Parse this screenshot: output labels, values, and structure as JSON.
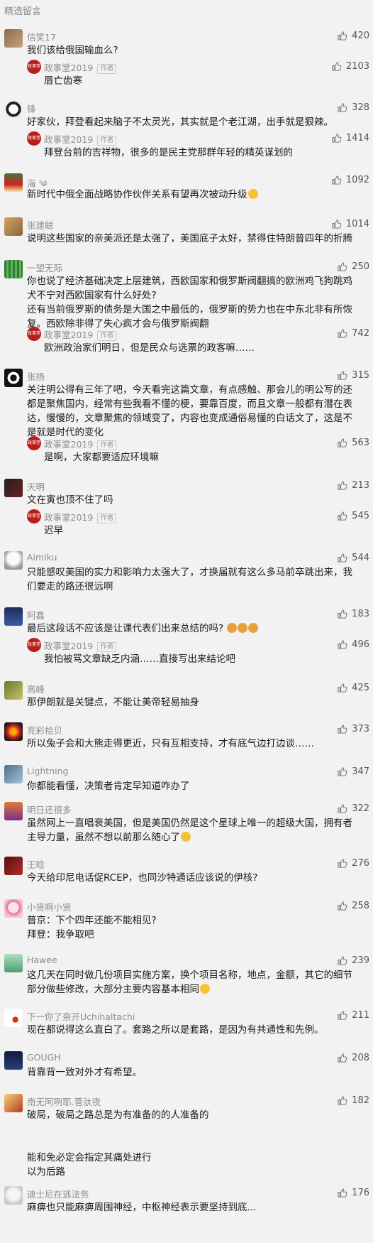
{
  "section_title": "精选留言",
  "author_name": "政事堂2019",
  "author_badge": "作者",
  "author_avatar_text": "政事堂",
  "like_icon": "thumbs-up-outline-icon",
  "comments": [
    {
      "name": "信笑17",
      "text": "我们该给俄国输血么?",
      "likes": "420",
      "reply": {
        "text": "唇亡齿寒",
        "likes": "2103"
      }
    },
    {
      "name": "锋",
      "text": "好家伙，拜登看起来脑子不太灵光，其实就是个老江湖，出手就是狠辣。",
      "likes": "328",
      "reply": {
        "text": "拜登台前的吉祥物，很多的是民主党那群年轻的精英谋划的",
        "likes": "1414"
      }
    },
    {
      "name": "海 ༄",
      "text": "新时代中俄全面战略协作伙伴关系有望再次被动升级",
      "likes": "1092"
    },
    {
      "name": "张建聪",
      "text": "说明这些国家的亲美派还是太强了，美国底子太好，禁得住特朗普四年的折腾",
      "likes": "1014"
    },
    {
      "name": "一望无际",
      "text": "你也说了经济基础决定上层建筑，西欧国家和俄罗斯阀翻搞的欧洲鸡飞狗跳鸡犬不宁对西欧国家有什么好处?\n还有当前俄罗斯的债务是大国之中最低的，俄罗斯的势力也在中东北非有所恢复。西欧除非得了失心疯才会与俄罗斯阀翻",
      "likes": "250",
      "reply": {
        "text": "欧洲政治家们明日，但是民众与选票的政客嘛……",
        "likes": "742"
      }
    },
    {
      "name": "张扬",
      "text": "关注明公得有三年了吧，今天看完这篇文章，有点感触、那会儿的明公写的还都是聚焦国内，经常有些我看不懂的梗，要靠百度，而且文章一般都有潜在表达，慢慢的，文章聚焦的领域变了，内容也变成通俗易懂的白话文了，这是不是就是时代的变化",
      "likes": "315",
      "reply": {
        "text": "是啊，大家都要适应环境嘛",
        "likes": "563"
      }
    },
    {
      "name": "天明",
      "text": "文在寅也顶不住了吗",
      "likes": "213",
      "reply": {
        "text": "迟早",
        "likes": "545"
      }
    },
    {
      "name": "Aimiku",
      "text": "只能感叹美国的实力和影响力太强大了，才换届就有这么多马前卒跳出来，我们要走的路还很远啊",
      "likes": "544"
    },
    {
      "name": "阿鑫",
      "text": "最后这段话不应该是让课代表们出来总结的吗?",
      "likes": "183",
      "reply": {
        "text": "我怕被骂文章缺乏内涵……直接写出来结论吧",
        "likes": "496"
      }
    },
    {
      "name": "高峰",
      "text": "那伊朗就是关键点，不能让美帝轻易抽身",
      "likes": "425"
    },
    {
      "name": "竞彩拾贝",
      "text": "所以兔子会和大熊走得更近，只有互相支持，才有底气边打边谈……",
      "likes": "373"
    },
    {
      "name": "Lightning",
      "text": "你都能看懂，决策者肯定早知道咋办了",
      "likes": "347"
    },
    {
      "name": "明日还很多",
      "text": "虽然网上一直唱衰美国，但是美国仍然是这个星球上唯一的超级大国，拥有者主导力量，虽然不想以前那么随心了",
      "likes": "322"
    },
    {
      "name": "王晗",
      "text": "今天给印尼电话促RCEP，也同沙特通话应该说的伊核?",
      "likes": "276"
    },
    {
      "name": "小贤啊小贤",
      "text": "普京：下个四年还能不能相见?\n拜登：我争取吧",
      "likes": "258"
    },
    {
      "name": "Hawee",
      "text": "这几天在同时做几份项目实施方案，换个项目名称，地点，金额，其它的细节部分做些修改，大部分主要内容基本相同",
      "likes": "239"
    },
    {
      "name": "下一你了奈开Uchihaltachi",
      "text": "现在都说得这么直白了。套路之所以是套路，是因为有共通性和先例。",
      "likes": "211"
    },
    {
      "name": "GOUGH",
      "text": "背靠背一致对外才有希望。",
      "likes": "208"
    },
    {
      "name": "南无阿咧耶.菩驮夜",
      "text": "破局，破局之路总是为有准备的的人准备的\n\n\n能和免必定会指定其痛处进行\n以为后路",
      "likes": "182"
    },
    {
      "name": "迪士尼在逃法务",
      "text": "麻痹也只能麻痹周围神经，中枢神经表示要坚持到底...",
      "likes": "176"
    }
  ]
}
